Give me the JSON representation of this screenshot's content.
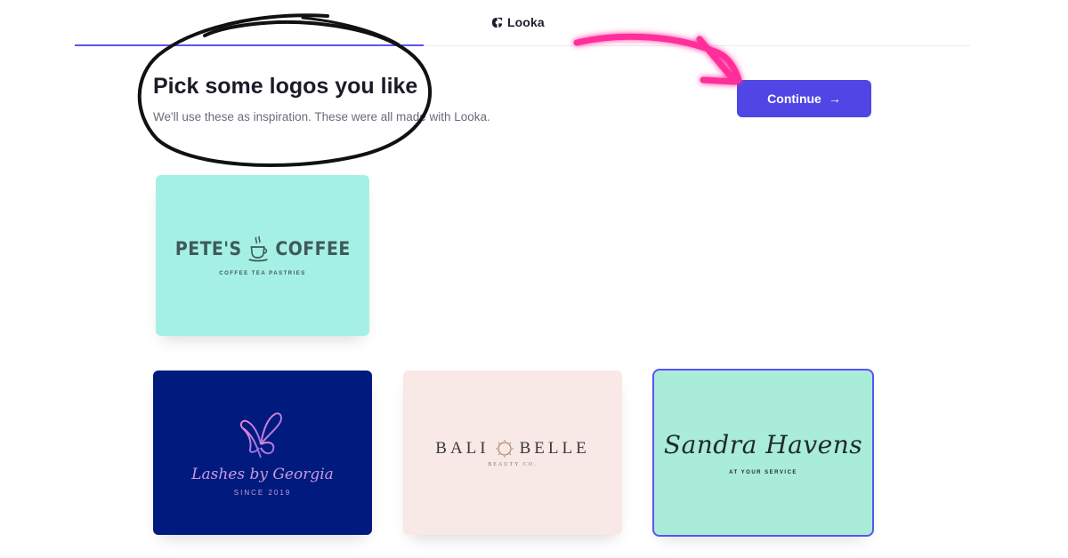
{
  "header": {
    "brand_name": "Looka",
    "progress_fraction": 0.39
  },
  "main": {
    "title": "Pick some logos you like",
    "subtitle": "We'll use these as inspiration. These were all made with Looka.",
    "continue_label": "Continue",
    "continue_icon": "arrow-right-icon"
  },
  "logos": [
    {
      "name": "PETE'S",
      "name2": "COFFEE",
      "tagline": "COFFEE TEA PASTRIES",
      "bg": "#a5f0e4",
      "selected": false
    },
    {
      "name": "Lashes by Georgia",
      "tagline": "SINCE 2019",
      "bg": "#001a7d",
      "selected": false
    },
    {
      "name": "BALI",
      "name2": "BELLE",
      "tagline": "BEAUTY CO.",
      "bg": "#f8e8e6",
      "selected": false
    },
    {
      "name": "Sandra Havens",
      "tagline": "AT YOUR SERVICE",
      "bg": "#a9ecd8",
      "selected": true
    }
  ],
  "colors": {
    "accent": "#4f46e5",
    "annotation_pink": "#ff2d9a",
    "annotation_ink": "#111111"
  }
}
